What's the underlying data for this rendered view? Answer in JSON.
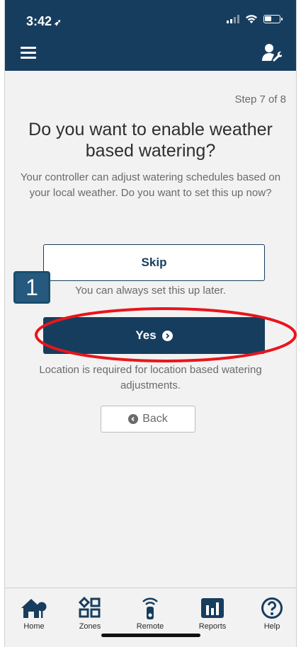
{
  "status_bar": {
    "time": "3:42",
    "location_glyph": "➶"
  },
  "header": {
    "menu_icon": "hamburger-menu-icon",
    "tools_icon": "user-wrench-icon"
  },
  "step_label": "Step 7 of 8",
  "title": "Do you want to enable weather based watering?",
  "description": "Your controller can adjust watering schedules based on your local weather. Do you want to set this up now?",
  "skip": {
    "label": "Skip",
    "note": "You can always set this up later."
  },
  "yes": {
    "label": "Yes"
  },
  "location_note": "Location is required for location based watering adjustments.",
  "back": {
    "label": "Back"
  },
  "annotation": {
    "marker": "1",
    "color": "#e8151b"
  },
  "tabs": [
    {
      "label": "Home",
      "icon": "home-icon"
    },
    {
      "label": "Zones",
      "icon": "zones-icon"
    },
    {
      "label": "Remote",
      "icon": "remote-icon"
    },
    {
      "label": "Reports",
      "icon": "reports-icon"
    },
    {
      "label": "Help",
      "icon": "help-icon"
    }
  ],
  "colors": {
    "primary": "#173d5e",
    "background": "#f2f2f2",
    "muted_text": "#6a6a6a"
  }
}
